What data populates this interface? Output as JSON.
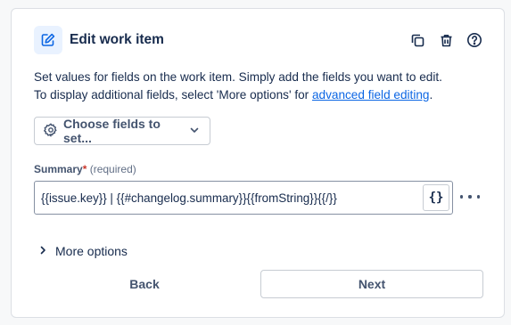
{
  "header": {
    "title": "Edit work item",
    "icons": [
      "edit-icon",
      "duplicate-icon",
      "trash-icon",
      "help-icon"
    ]
  },
  "description": {
    "line1": "Set values for fields on the work item. Simply add the fields you want to edit.",
    "line2_prefix": "To display additional fields, select 'More options' for ",
    "line2_link": "advanced field editing",
    "line2_suffix": "."
  },
  "choose_fields": {
    "label": "Choose fields to set...",
    "icons": [
      "gear-icon",
      "chevron-down-icon"
    ]
  },
  "summary_field": {
    "label": "Summary",
    "required_mark": "*",
    "required_hint": "(required)",
    "value": "{{issue.key}} | {{#changelog.summary}}{{fromString}}{{/}}",
    "smart_value_button": "{}"
  },
  "more_options": {
    "label": "More options"
  },
  "footer": {
    "back_label": "Back",
    "next_label": "Next"
  },
  "colors": {
    "link": "#0c66e4",
    "required": "#c9372c",
    "header_icon_bg": "#e9f2ff",
    "text": "#172b4d"
  }
}
